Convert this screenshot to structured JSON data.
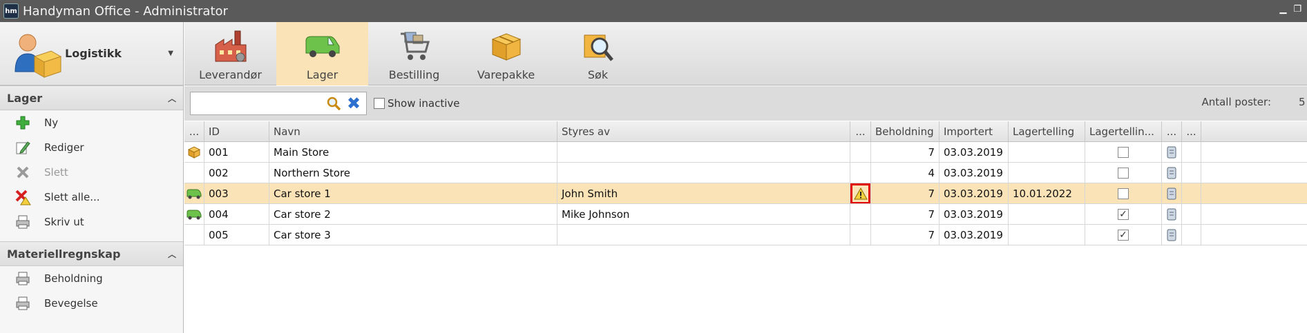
{
  "window": {
    "title": "Handyman Office - Administrator",
    "app_icon_text": "hm"
  },
  "module": {
    "label": "Logistikk"
  },
  "sections": [
    {
      "title": "Lager",
      "items": [
        {
          "label": "Ny",
          "icon": "plus-icon",
          "disabled": false
        },
        {
          "label": "Rediger",
          "icon": "edit-icon",
          "disabled": false
        },
        {
          "label": "Slett",
          "icon": "delete-icon",
          "disabled": true
        },
        {
          "label": "Slett alle...",
          "icon": "delete-all-icon",
          "disabled": false
        },
        {
          "label": "Skriv ut",
          "icon": "print-icon",
          "disabled": false
        }
      ]
    },
    {
      "title": "Materiellregnskap",
      "items": [
        {
          "label": "Beholdning",
          "icon": "print-icon",
          "disabled": false
        },
        {
          "label": "Bevegelse",
          "icon": "print-icon",
          "disabled": false
        }
      ]
    }
  ],
  "toolbar": {
    "buttons": [
      {
        "label": "Leverandør",
        "icon": "factory-icon",
        "active": false
      },
      {
        "label": "Lager",
        "icon": "van-icon",
        "active": true
      },
      {
        "label": "Bestilling",
        "icon": "cart-icon",
        "active": false
      },
      {
        "label": "Varepakke",
        "icon": "boxes-icon",
        "active": false
      },
      {
        "label": "Søk",
        "icon": "magnifier-icon",
        "active": false
      }
    ]
  },
  "search": {
    "value": "",
    "placeholder": "",
    "show_inactive_label": "Show inactive",
    "show_inactive_checked": false,
    "count_label": "Antall poster:",
    "count_value": "5"
  },
  "grid": {
    "columns": [
      "...",
      "ID",
      "Navn",
      "Styres av",
      "...",
      "Beholdning",
      "Importert",
      "Lagertelling",
      "Lagertellin...",
      "...",
      "..."
    ],
    "rows": [
      {
        "type_icon": "box-icon",
        "id": "001",
        "name": "Main Store",
        "managed_by": "",
        "warning": false,
        "stock": "7",
        "imported": "03.03.2019",
        "count_date": "",
        "counting": false,
        "selected": false
      },
      {
        "type_icon": "",
        "id": "002",
        "name": "Northern Store",
        "managed_by": "",
        "warning": false,
        "stock": "4",
        "imported": "03.03.2019",
        "count_date": "",
        "counting": false,
        "selected": false
      },
      {
        "type_icon": "van-icon",
        "id": "003",
        "name": "Car store 1",
        "managed_by": "John Smith",
        "warning": true,
        "stock": "7",
        "imported": "03.03.2019",
        "count_date": "10.01.2022",
        "counting": false,
        "selected": true
      },
      {
        "type_icon": "van-icon",
        "id": "004",
        "name": "Car store 2",
        "managed_by": "Mike Johnson",
        "warning": false,
        "stock": "7",
        "imported": "03.03.2019",
        "count_date": "",
        "counting": true,
        "selected": false
      },
      {
        "type_icon": "",
        "id": "005",
        "name": "Car store 3",
        "managed_by": "",
        "warning": false,
        "stock": "7",
        "imported": "03.03.2019",
        "count_date": "",
        "counting": true,
        "selected": false
      }
    ]
  }
}
